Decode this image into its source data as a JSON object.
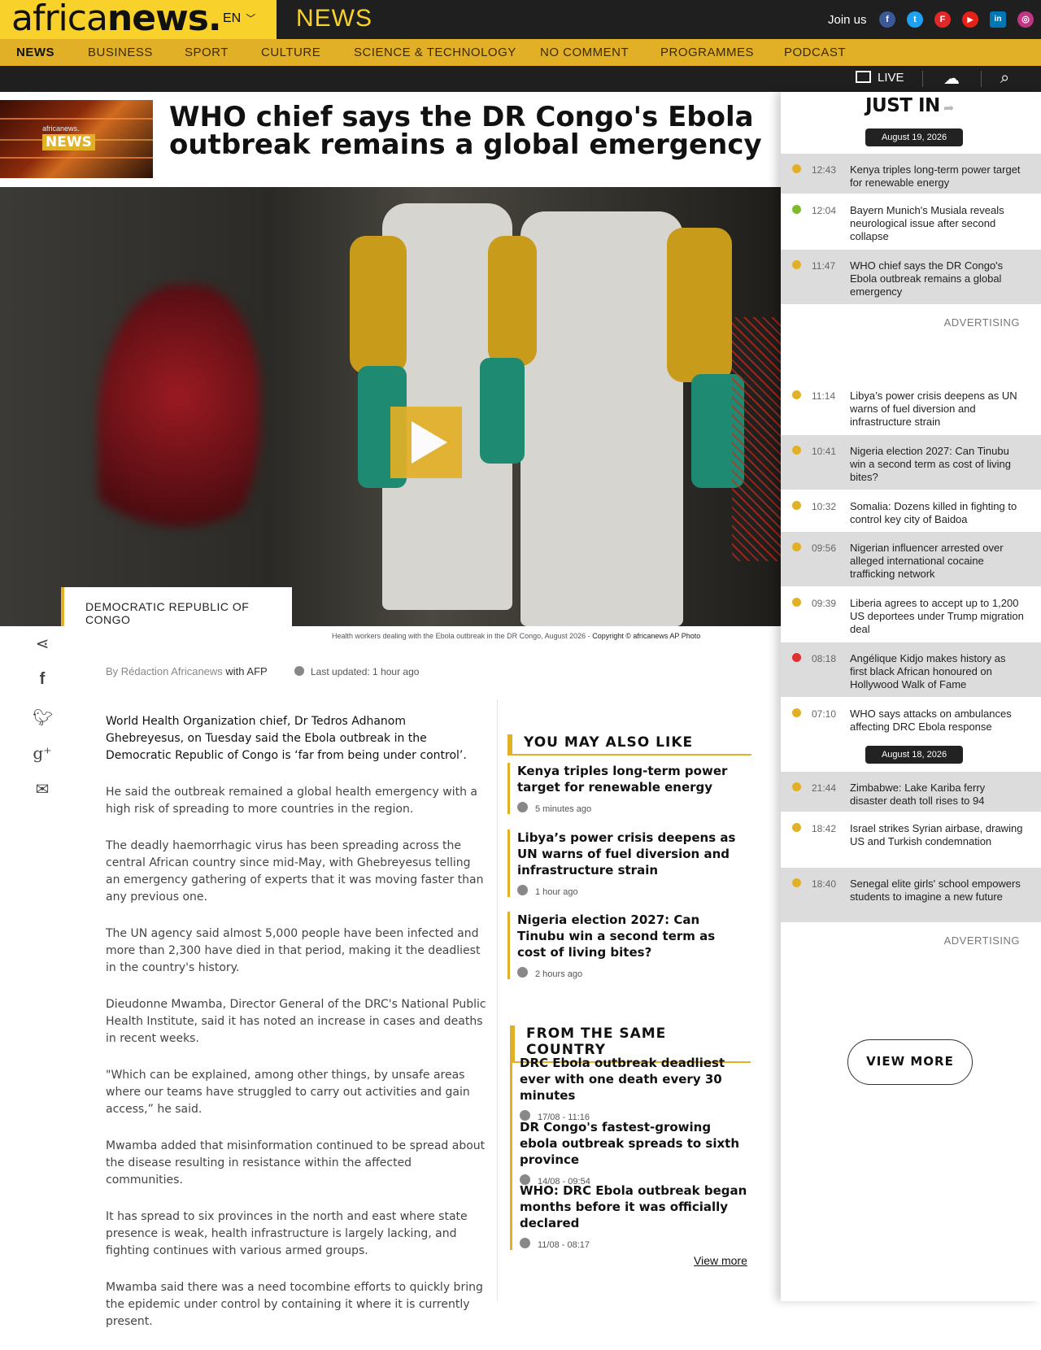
{
  "header": {
    "logo_light": "africa",
    "logo_bold": "news.",
    "lang": "EN",
    "section": "NEWS",
    "join": "Join us",
    "social": [
      {
        "name": "facebook-icon",
        "glyph": "f",
        "color": "#3b5998"
      },
      {
        "name": "twitter-icon",
        "glyph": "t",
        "color": "#1da1f2"
      },
      {
        "name": "flipboard-icon",
        "glyph": "F",
        "color": "#e12828"
      },
      {
        "name": "youtube-icon",
        "glyph": "▶",
        "color": "#e62117"
      },
      {
        "name": "linkedin-icon",
        "glyph": "in",
        "color": "#0077b5"
      },
      {
        "name": "instagram-icon",
        "glyph": "◎",
        "color": "#c13584"
      }
    ]
  },
  "nav": [
    "NEWS",
    "BUSINESS",
    "SPORT",
    "CULTURE",
    "SCIENCE & TECHNOLOGY",
    "NO COMMENT",
    "PROGRAMMES",
    "PODCAST"
  ],
  "subbar": {
    "live": "LIVE"
  },
  "article": {
    "thumb_logo": "africanews.",
    "thumb_news": "NEWS",
    "headline": "WHO chief says the DR Congo's Ebola outbreak remains a global emergency",
    "country": "DEMOCRATIC REPUBLIC OF CONGO",
    "caption": "Health workers dealing with the Ebola outbreak in the DR Congo, August 2026  -  ",
    "copyright": "Copyright © africanews  AP Photo",
    "byline_by": "By Rédaction Africanews",
    "byline_with": " with AFP",
    "updated": "Last updated: 1 hour ago",
    "paragraphs": [
      "World Health Organization chief, Dr Tedros Adhanom Ghebreyesus, on Tuesday said the Ebola outbreak in the Democratic Republic of Congo is ‘far from being under control’.",
      "He said the outbreak remained a global health emergency with a high risk of spreading to more countries in the region.",
      "The deadly haemorrhagic virus has been spreading across the central African country since mid-May, with Ghebreyesus telling an emergency gathering of experts that it was moving faster than any previous one.",
      "The UN agency said almost 5,000 people have been infected and more than 2,300 have died in that period, making it the deadliest in the country's history.",
      "Dieudonne Mwamba, Director General of the DRC's National Public Health Institute, said it has noted an increase in cases and deaths in recent weeks.",
      "\"Which can be explained, among other things, by unsafe areas where our teams have struggled to carry out activities and gain access,” he said.",
      "Mwamba added that misinformation continued to be spread about the disease resulting in resistance within the affected communities.",
      "It has spread to six provinces in the north and east where state presence is weak, health infrastructure is largely lacking, and fighting continues with various armed groups.",
      "Mwamba said there was a need tocombine efforts to quickly bring the epidemic under control by containing it where it is currently present."
    ]
  },
  "also_like": {
    "title": "YOU MAY ALSO LIKE",
    "items": [
      {
        "title": "Kenya triples long-term power target for renewable energy",
        "meta": "5 minutes ago"
      },
      {
        "title": "Libya’s power crisis deepens as UN warns of fuel diversion and infrastructure strain",
        "meta": "1 hour ago"
      },
      {
        "title": "Nigeria election 2027: Can Tinubu win a second term as cost of living bites?",
        "meta": "2 hours ago"
      }
    ]
  },
  "same_country": {
    "title": "FROM THE SAME COUNTRY",
    "items": [
      {
        "title": "DRC Ebola outbreak deadliest ever with one death every 30 minutes",
        "meta": "17/08 - 11:16"
      },
      {
        "title": "DR Congo's fastest-growing ebola outbreak spreads to sixth province",
        "meta": "14/08 - 09:54"
      },
      {
        "title": "WHO: DRC Ebola outbreak began months before it was officially declared",
        "meta": "11/08 - 08:17"
      }
    ],
    "view_more": "View more"
  },
  "just_in": {
    "title": "JUST IN",
    "date1": "August 19, 2026",
    "date2": "August 18, 2026",
    "advertising": "ADVERTISING",
    "view_more": "VIEW MORE",
    "items": [
      {
        "time": "12:43",
        "text": "Kenya triples long-term power target for renewable energy",
        "color": "#e2b027"
      },
      {
        "time": "12:04",
        "text": "Bayern Munich's Musiala reveals neurological issue after second collapse",
        "color": "#7dbb2a"
      },
      {
        "time": "11:47",
        "text": "WHO chief says the DR Congo's Ebola outbreak remains a global emergency",
        "color": "#e2b027"
      },
      {
        "time": "11:14",
        "text": "Libya’s power crisis deepens as UN warns of fuel diversion and infrastructure strain",
        "color": "#e2b027"
      },
      {
        "time": "10:41",
        "text": "Nigeria election 2027: Can Tinubu win a second term as cost of living bites?",
        "color": "#e2b027"
      },
      {
        "time": "10:32",
        "text": "Somalia: Dozens killed in fighting to control key city of Baidoa",
        "color": "#e2b027"
      },
      {
        "time": "09:56",
        "text": "Nigerian influencer arrested over alleged international cocaine trafficking network",
        "color": "#e2b027"
      },
      {
        "time": "09:39",
        "text": "Liberia agrees to accept up to 1,200 US deportees under Trump migration deal",
        "color": "#e2b027"
      },
      {
        "time": "08:18",
        "text": "Angélique Kidjo makes history as first black African honoured on Hollywood Walk of Fame",
        "color": "#e03030"
      },
      {
        "time": "07:10",
        "text": "WHO says attacks on ambulances affecting DRC Ebola response",
        "color": "#e2b027"
      },
      {
        "time": "21:44",
        "text": "Zimbabwe: Lake Kariba ferry disaster death toll rises to 94",
        "color": "#e2b027"
      },
      {
        "time": "18:42",
        "text": "Israel strikes Syrian airbase, drawing US and Turkish condemnation",
        "color": "#e2b027"
      },
      {
        "time": "18:40",
        "text": "Senegal elite girls' school empowers students to imagine a new future",
        "color": "#e2b027"
      }
    ]
  }
}
